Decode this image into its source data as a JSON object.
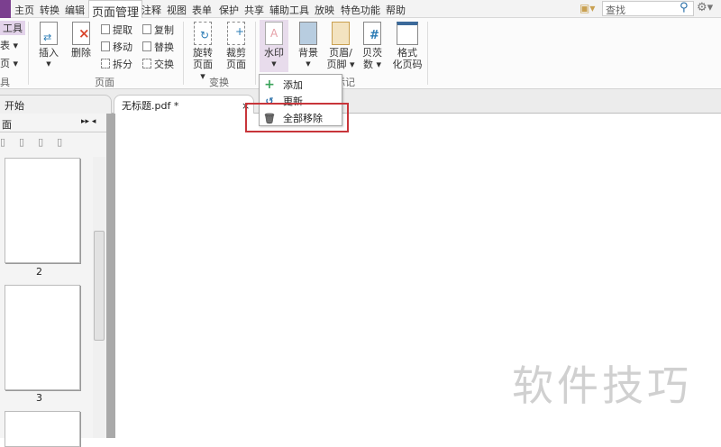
{
  "menu": {
    "items": [
      "主页",
      "转换",
      "编辑",
      "页面管理",
      "注释",
      "视图",
      "表单",
      "保护",
      "共享",
      "辅助工具",
      "放映",
      "特色功能",
      "帮助"
    ],
    "search_placeholder": "查找"
  },
  "ribbon": {
    "left_partial": [
      "工具",
      "表 ▾",
      "页 ▾",
      "具"
    ],
    "insert": "插入",
    "delete": "删除",
    "extract": "提取",
    "move": "移动",
    "split": "拆分",
    "copy": "复制",
    "replace": "替换",
    "swap": "交换",
    "group_pages": "页面",
    "rotate": "旋转",
    "rotate2": "页面 ▾",
    "crop": "裁剪",
    "crop2": "页面",
    "group_transform": "变换",
    "watermark": "水印",
    "background": "背景",
    "header": "页眉/",
    "header2": "页脚 ▾",
    "pagenum": "贝茨",
    "pagenum2": "数 ▾",
    "format": "格式",
    "format2": "化页码",
    "group_mark": "标记"
  },
  "tabs": {
    "start": "开始",
    "doc": "无标题.pdf *",
    "close": "×"
  },
  "panel": {
    "title": "面",
    "pages": [
      "2",
      "3"
    ]
  },
  "dropdown": {
    "add": "添加",
    "update": "更新",
    "remove_all": "全部移除"
  },
  "watermark_text": "软件技巧"
}
